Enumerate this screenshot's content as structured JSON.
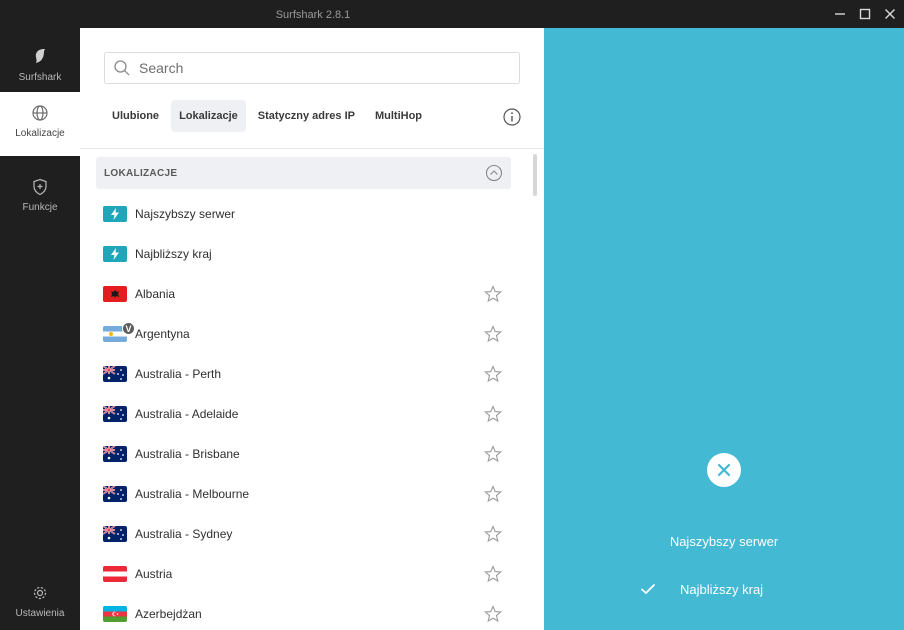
{
  "window": {
    "title": "Surfshark 2.8.1",
    "minimize_icon": "minimize-icon",
    "maximize_icon": "maximize-icon",
    "close_icon": "close-icon"
  },
  "sidebar": {
    "items": [
      {
        "label": "Surfshark",
        "icon": "surfshark-logo-icon",
        "active": false
      },
      {
        "label": "Lokalizacje",
        "icon": "globe-icon",
        "active": true
      },
      {
        "label": "Funkcje",
        "icon": "shield-plus-icon",
        "active": false
      },
      {
        "label": "Ustawienia",
        "icon": "gear-icon",
        "active": false
      }
    ]
  },
  "search": {
    "placeholder": "Search",
    "value": ""
  },
  "tabs": [
    {
      "label": "Ulubione",
      "active": false
    },
    {
      "label": "Lokalizacje",
      "active": true
    },
    {
      "label": "Statyczny adres IP",
      "active": false
    },
    {
      "label": "MultiHop",
      "active": false
    }
  ],
  "section": {
    "title": "LOKALIZACJE"
  },
  "locations": [
    {
      "name": "Najszybszy serwer",
      "flag": "bolt"
    },
    {
      "name": "Najbliższy kraj",
      "flag": "bolt"
    },
    {
      "name": "Albania",
      "flag": "albania"
    },
    {
      "name": "Argentyna",
      "flag": "argentina",
      "badge": "V"
    },
    {
      "name": "Australia - Perth",
      "flag": "australia"
    },
    {
      "name": "Australia - Adelaide",
      "flag": "australia"
    },
    {
      "name": "Australia - Brisbane",
      "flag": "australia"
    },
    {
      "name": "Australia - Melbourne",
      "flag": "australia"
    },
    {
      "name": "Australia - Sydney",
      "flag": "australia"
    },
    {
      "name": "Austria",
      "flag": "austria"
    },
    {
      "name": "Azerbejdżan",
      "flag": "azerbaijan"
    }
  ],
  "quick_connect": {
    "option1": "Najszybszy serwer",
    "option2": "Najbliższy kraj",
    "selected": "Najbliższy kraj"
  },
  "colors": {
    "accent": "#43b9d3",
    "bolt": "#1fa6b8",
    "sidebar": "#1f1f1f"
  }
}
